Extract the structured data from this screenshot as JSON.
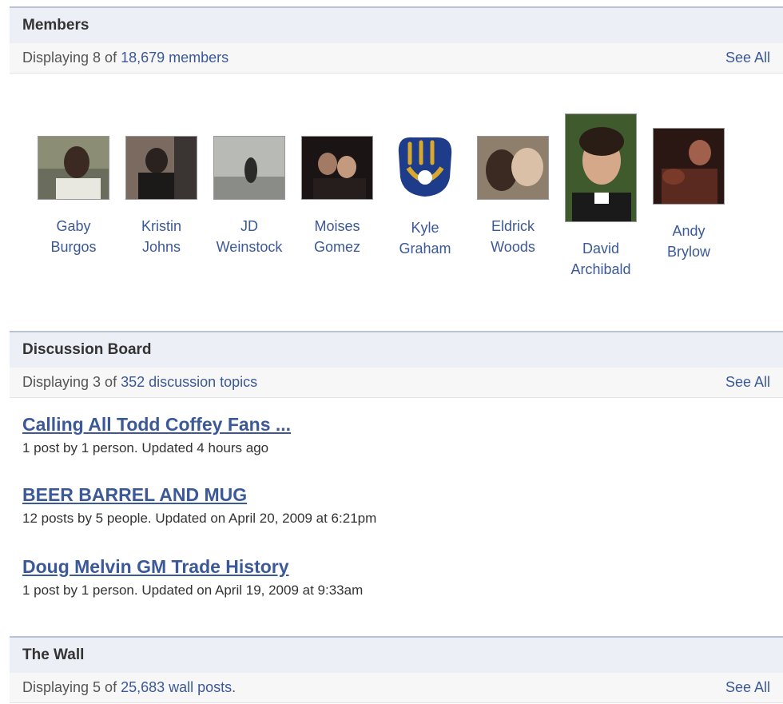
{
  "members": {
    "header": "Members",
    "display_prefix": "Displaying 8 of ",
    "display_link": "18,679 members",
    "see_all": "See All",
    "list": [
      {
        "first": "Gaby",
        "last": "Burgos"
      },
      {
        "first": "Kristin",
        "last": "Johns"
      },
      {
        "first": "JD",
        "last": "Weinstock"
      },
      {
        "first": "Moises",
        "last": "Gomez"
      },
      {
        "first": "Kyle",
        "last": "Graham"
      },
      {
        "first": "Eldrick",
        "last": "Woods"
      },
      {
        "first": "David",
        "last": "Archibald"
      },
      {
        "first": "Andy",
        "last": "Brylow"
      }
    ]
  },
  "discussion": {
    "header": "Discussion Board",
    "display_prefix": "Displaying 3 of ",
    "display_link": "352 discussion topics",
    "see_all": "See All",
    "topics": [
      {
        "title": "Calling All Todd Coffey Fans ...",
        "meta": "1 post by 1 person. Updated 4 hours ago"
      },
      {
        "title": "BEER BARREL AND MUG",
        "meta": "12 posts by 5 people. Updated on April 20, 2009 at 6:21pm"
      },
      {
        "title": "Doug Melvin GM Trade History",
        "meta": "1 post by 1 person. Updated on April 19, 2009 at 9:33am"
      }
    ]
  },
  "wall": {
    "header": "The Wall",
    "display_prefix": "Displaying 5 of ",
    "display_link": "25,683 wall posts",
    "display_suffix": ".",
    "see_all": "See All"
  },
  "colors": {
    "link": "#3b5998",
    "header_bg": "#eceff5",
    "header_border": "#b9c3d8",
    "brewers_blue": "#1f3c8b",
    "brewers_gold": "#d9a92b"
  }
}
